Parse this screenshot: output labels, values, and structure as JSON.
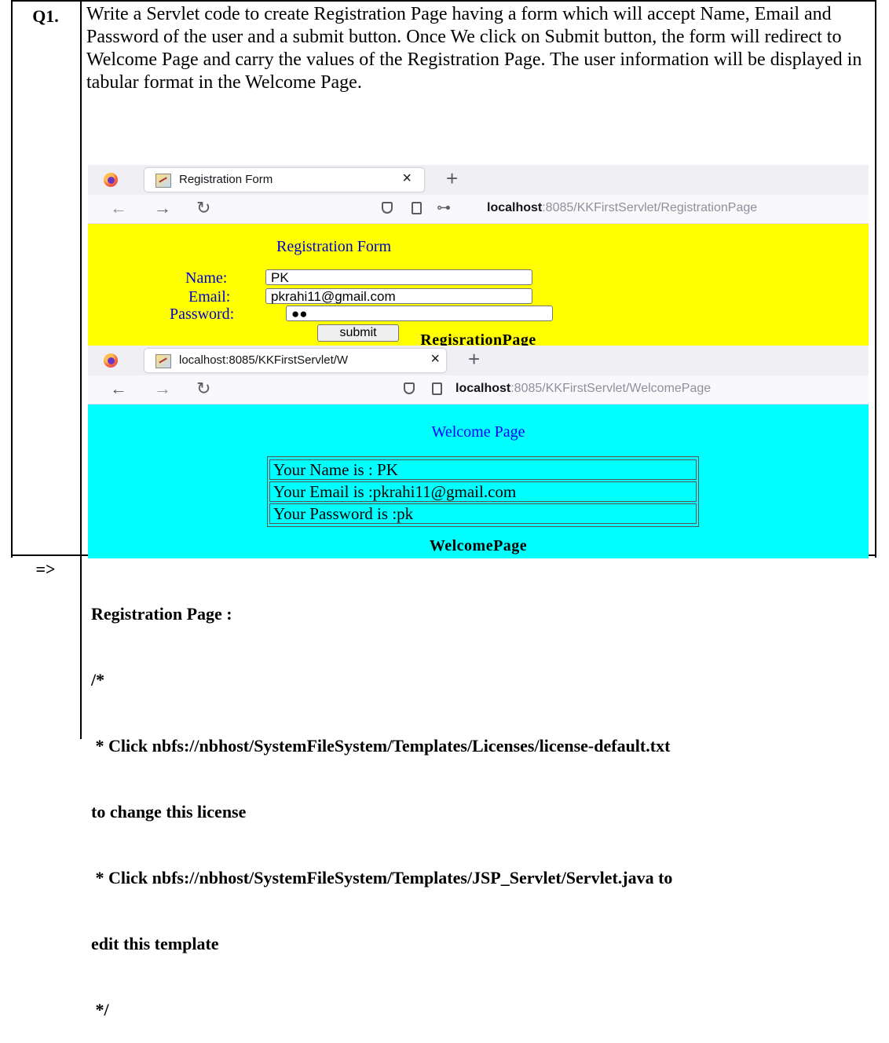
{
  "question": {
    "label": "Q1.",
    "text": "Write a Servlet code to create Registration Page having a form which will accept Name, Email and   Password of the user and a submit button. Once We click on Submit button, the form will redirect to Welcome Page and carry the values of the Registration Page. The user information will be displayed in tabular format in the Welcome Page."
  },
  "registration_browser": {
    "tab_title": "Registration Form",
    "tab_close": "×",
    "new_tab": "+",
    "url_host": "localhost",
    "url_rest": ":8085/KKFirstServlet/RegistrationPage",
    "page": {
      "heading": "Registration Form",
      "name_label": "Name:",
      "name_value": "PK",
      "email_label": "Email:",
      "email_value": "pkrahi11@gmail.com",
      "password_label": "Password:",
      "password_value": "●●",
      "submit_label": "submit"
    },
    "caption": "RegisrationPage"
  },
  "welcome_browser": {
    "tab_title": "localhost:8085/KKFirstServlet/W",
    "tab_close": "×",
    "new_tab": "+",
    "url_host": "localhost",
    "url_rest": ":8085/KKFirstServlet/WelcomePage",
    "page": {
      "heading": "Welcome Page",
      "rows": [
        "Your Name is : PK",
        "Your Email is :pkrahi11@gmail.com",
        "Your Password is :pk"
      ]
    },
    "caption": "WelcomePage"
  },
  "answer": {
    "label": "=>",
    "lines": [
      "Registration Page :",
      "/*",
      " * Click nbfs://nbhost/SystemFileSystem/Templates/Licenses/license-default.txt",
      "to change this license",
      " * Click nbfs://nbhost/SystemFileSystem/Templates/JSP_Servlet/Servlet.java to",
      "edit this template",
      " */"
    ]
  }
}
